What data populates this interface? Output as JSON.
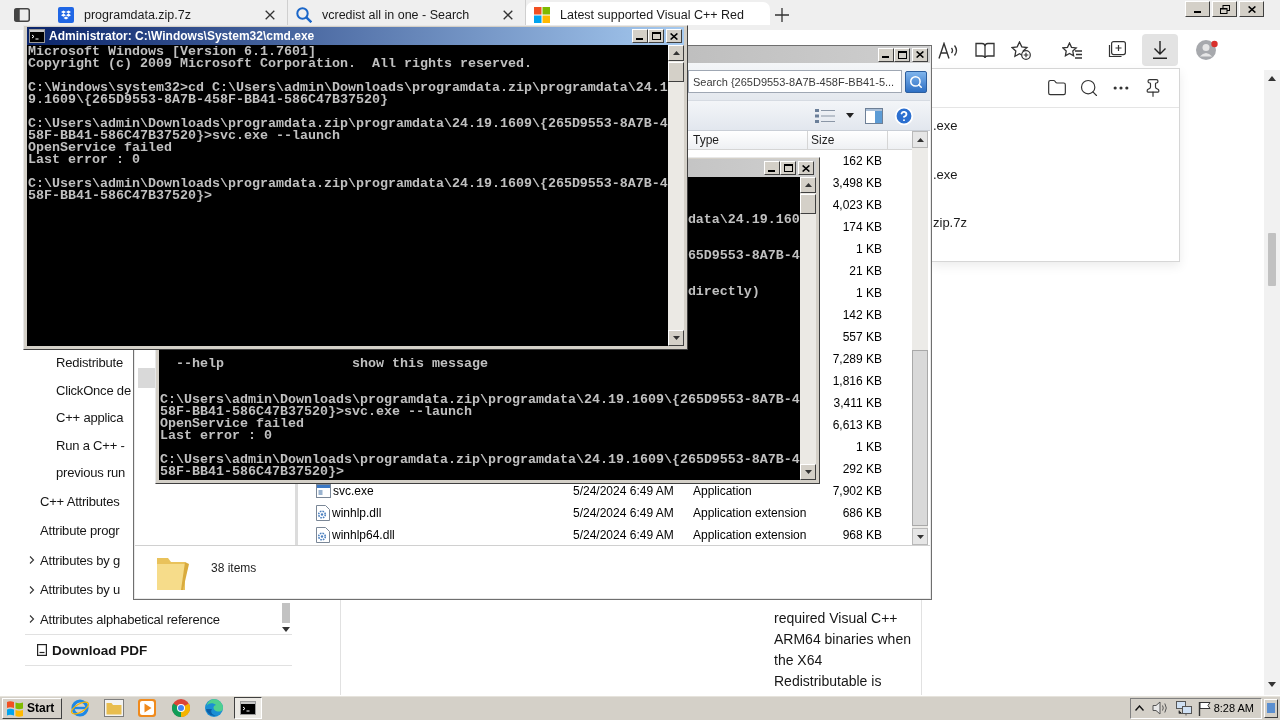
{
  "browser": {
    "tabs": [
      {
        "kind": "archive",
        "title": "programdata.zip.7z",
        "selected": false
      },
      {
        "kind": "search",
        "title": "vcredist all in one - Search",
        "selected": false
      },
      {
        "kind": "tiles",
        "title": "Latest supported Visual C++ Red",
        "selected": true
      }
    ],
    "toolbar": [
      {
        "kind": "read-aloud",
        "selected": false
      },
      {
        "kind": "reader",
        "selected": false
      },
      {
        "kind": "add-favorite",
        "selected": false
      },
      {
        "kind": "favorites",
        "selected": false
      },
      {
        "kind": "collections",
        "selected": false
      },
      {
        "kind": "downloads",
        "selected": true
      },
      {
        "kind": "profile",
        "selected": false
      }
    ],
    "downloads_panel": {
      "items": [
        {
          "name": ".exe"
        },
        {
          "name": ".exe"
        },
        {
          "name": "zip.7z"
        }
      ]
    },
    "sidebar": {
      "toc": [
        {
          "children": [
            {
              "label": "Redistribute"
            },
            {
              "label": "ClickOnce de"
            },
            {
              "label": "C++ applica"
            },
            {
              "label": "Run a C++ -"
            },
            {
              "label": "previous run"
            }
          ]
        },
        {
          "label": "C++ Attributes"
        },
        {
          "label": "Attribute progr"
        },
        {
          "label": "Attributes by g",
          "expanded": false
        },
        {
          "label": "Attributes by u",
          "expanded": false
        },
        {
          "label": "Attributes alphabetical reference",
          "expanded": false
        }
      ],
      "download_pdf": "Download PDF"
    },
    "article": {
      "text": "required Visual C++ ARM64 binaries when the X64 Redistributable is"
    }
  },
  "explorer": {
    "active": false,
    "search": {
      "placeholder": "Search {265D9553-8A7B-458F-BB41-5..."
    },
    "toolbar": [
      {
        "kind": "views"
      },
      {
        "kind": "view-menu"
      },
      {
        "kind": "preview-pane"
      },
      {
        "kind": "help"
      }
    ],
    "nav_pane": {
      "items": [
        {
          "selected": true
        }
      ]
    },
    "columns": [
      {
        "label": "Type"
      },
      {
        "label": "Size"
      }
    ],
    "rows": [
      {
        "size": "162 KB"
      },
      {
        "size": "3,498 KB"
      },
      {
        "size": "4,023 KB"
      },
      {
        "size": "174 KB"
      },
      {
        "size": "1 KB"
      },
      {
        "size": "21 KB"
      },
      {
        "size": "1 KB"
      },
      {
        "size": "142 KB"
      },
      {
        "size": "557 KB"
      },
      {
        "size": "7,289 KB"
      },
      {
        "size": "1,816 KB"
      },
      {
        "size": "3,411 KB"
      },
      {
        "size": "6,613 KB"
      },
      {
        "size": "1 KB"
      },
      {
        "size": "292 KB"
      },
      {
        "kind": "application",
        "name": "svc.exe",
        "modified": "5/24/2024 6:49 AM",
        "type": "Application",
        "size": "7,902 KB"
      },
      {
        "kind": "extension",
        "name": "winhlp.dll",
        "modified": "5/24/2024 6:49 AM",
        "type": "Application extension",
        "size": "686 KB"
      },
      {
        "kind": "extension",
        "name": "winhlp64.dll",
        "modified": "5/24/2024 6:49 AM",
        "type": "Application extension",
        "size": "968 KB"
      }
    ],
    "status": "38 items"
  },
  "cmd_back": {
    "active": false,
    "clipped_lines": [
      "data\\24.19.160",
      "65D9553-8A7B-4",
      "directly)"
    ],
    "help": [
      {
        "option": "--help",
        "description": "show this message"
      }
    ],
    "blocks": [
      [
        "C:\\Users\\admin\\Downloads\\programdata.zip\\programdata\\24.19.1609\\{265D9553-8A7B-4",
        "58F-BB41-586C47B37520}>svc.exe --launch",
        "OpenService failed",
        "Last error : 0"
      ],
      [
        "C:\\Users\\admin\\Downloads\\programdata.zip\\programdata\\24.19.1609\\{265D9553-8A7B-4",
        "58F-BB41-586C47B37520}>"
      ]
    ]
  },
  "cmd_front": {
    "active": true,
    "title": "Administrator: C:\\Windows\\System32\\cmd.exe",
    "blocks": [
      [
        "Microsoft Windows [Version 6.1.7601]",
        "Copyright (c) 2009 Microsoft Corporation.  All rights reserved."
      ],
      [
        "C:\\Windows\\system32>cd C:\\Users\\admin\\Downloads\\programdata.zip\\programdata\\24.1",
        "9.1609\\{265D9553-8A7B-458F-BB41-586C47B37520}"
      ],
      [
        "C:\\Users\\admin\\Downloads\\programdata.zip\\programdata\\24.19.1609\\{265D9553-8A7B-4",
        "58F-BB41-586C47B37520}>svc.exe --launch",
        "OpenService failed",
        "Last error : 0"
      ],
      [
        "C:\\Users\\admin\\Downloads\\programdata.zip\\programdata\\24.19.1609\\{265D9553-8A7B-4",
        "58F-BB41-586C47B37520}>"
      ]
    ]
  },
  "taskbar": {
    "start": "Start",
    "apps": [
      {
        "kind": "ie",
        "selected": false
      },
      {
        "kind": "folder",
        "selected": false
      },
      {
        "kind": "media",
        "selected": false
      },
      {
        "kind": "chrome",
        "selected": false
      },
      {
        "kind": "edge",
        "selected": false
      },
      {
        "kind": "console",
        "selected": true
      }
    ],
    "tray": [
      {
        "kind": "chevron"
      },
      {
        "kind": "volume"
      },
      {
        "kind": "network"
      },
      {
        "kind": "flag"
      }
    ],
    "clock": "8:28 AM"
  }
}
